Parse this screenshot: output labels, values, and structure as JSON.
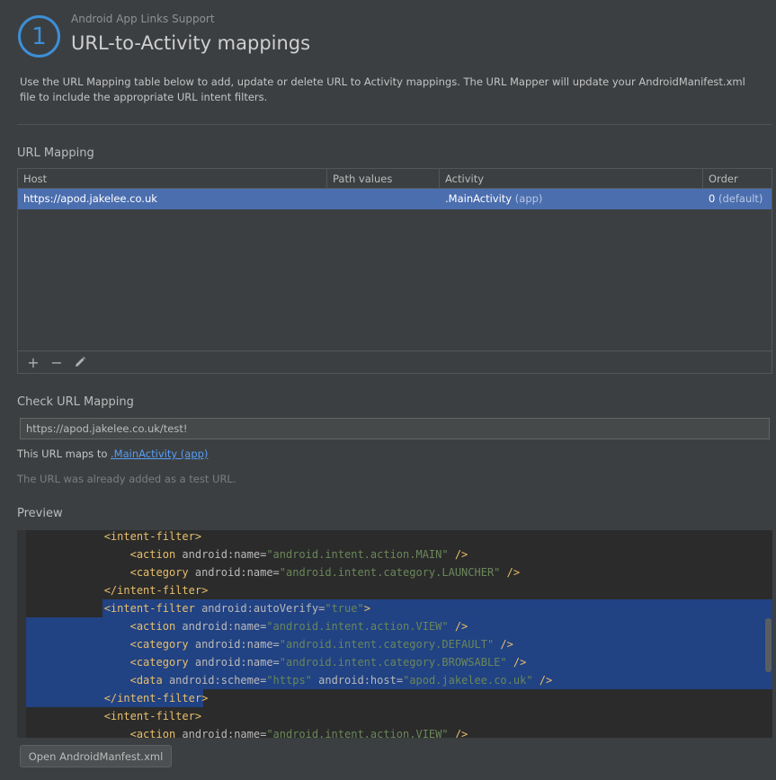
{
  "header": {
    "step_number": "1",
    "subtitle": "Android App Links Support",
    "title": "URL-to-Activity mappings",
    "description": "Use the URL Mapping table below to add, update or delete URL to Activity mappings. The URL Mapper will update your AndroidManifest.xml file to include the appropriate URL intent filters."
  },
  "url_mapping": {
    "section_label": "URL Mapping",
    "columns": [
      "Host",
      "Path values",
      "Activity",
      "Order"
    ],
    "rows": [
      {
        "host": "https://apod.jakelee.co.uk",
        "path_values": "",
        "activity": ".MainActivity",
        "activity_module": "(app)",
        "order": "0",
        "order_note": "(default)"
      }
    ],
    "toolbar": {
      "add_icon": "+",
      "remove_icon": "−",
      "edit_icon": "✎"
    }
  },
  "check": {
    "section_label": "Check URL Mapping",
    "input_value": "https://apod.jakelee.co.uk/test!",
    "result_prefix": "This URL maps to",
    "result_link": ".MainActivity (app)",
    "note": "The URL was already added as a test URL."
  },
  "preview": {
    "section_label": "Preview",
    "lines": [
      {
        "indent": "            ",
        "parts": [
          [
            "tag",
            "<intent-filter>"
          ]
        ]
      },
      {
        "indent": "                ",
        "parts": [
          [
            "tag",
            "<action "
          ],
          [
            "attr",
            "android:name="
          ],
          [
            "val",
            "\"android.intent.action.MAIN\""
          ],
          [
            "tag",
            " />"
          ]
        ]
      },
      {
        "indent": "                ",
        "parts": [
          [
            "tag",
            "<category "
          ],
          [
            "attr",
            "android:name="
          ],
          [
            "val",
            "\"android.intent.category.LAUNCHER\""
          ],
          [
            "tag",
            " />"
          ]
        ]
      },
      {
        "indent": "            ",
        "parts": [
          [
            "tag",
            "</intent-filter>"
          ]
        ]
      },
      {
        "indent": "            ",
        "parts": [
          [
            "tag",
            "<intent-filter "
          ],
          [
            "attr",
            "android:autoVerify="
          ],
          [
            "val",
            "\"true\""
          ],
          [
            "tag",
            ">"
          ]
        ]
      },
      {
        "indent": "                ",
        "parts": [
          [
            "tag",
            "<action "
          ],
          [
            "attr",
            "android:name="
          ],
          [
            "val",
            "\"android.intent.action.VIEW\""
          ],
          [
            "tag",
            " />"
          ]
        ]
      },
      {
        "indent": "                ",
        "parts": [
          [
            "tag",
            "<category "
          ],
          [
            "attr",
            "android:name="
          ],
          [
            "val",
            "\"android.intent.category.DEFAULT\""
          ],
          [
            "tag",
            " />"
          ]
        ]
      },
      {
        "indent": "                ",
        "parts": [
          [
            "tag",
            "<category "
          ],
          [
            "attr",
            "android:name="
          ],
          [
            "val",
            "\"android.intent.category.BROWSABLE\""
          ],
          [
            "tag",
            " />"
          ]
        ]
      },
      {
        "indent": "                ",
        "parts": [
          [
            "tag",
            "<data "
          ],
          [
            "attr",
            "android:scheme="
          ],
          [
            "val",
            "\"https\""
          ],
          [
            "attr",
            " android:host="
          ],
          [
            "val",
            "\"apod.jakelee.co.uk\""
          ],
          [
            "tag",
            " />"
          ]
        ]
      },
      {
        "indent": "            ",
        "parts": [
          [
            "tag",
            "</intent-filter>"
          ]
        ]
      },
      {
        "indent": "            ",
        "parts": [
          [
            "tag",
            "<intent-filter>"
          ]
        ]
      },
      {
        "indent": "                ",
        "parts": [
          [
            "tag",
            "<action "
          ],
          [
            "attr",
            "android:name="
          ],
          [
            "val",
            "\"android.intent.action.VIEW\""
          ],
          [
            "tag",
            " />"
          ]
        ]
      }
    ]
  },
  "footer": {
    "open_button_label": "Open AndroidManfest.xml"
  }
}
